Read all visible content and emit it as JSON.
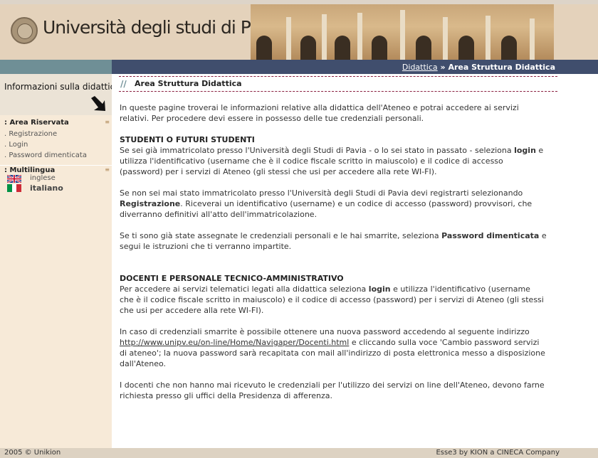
{
  "header": {
    "university_name": "Università degli studi di Pavia"
  },
  "breadcrumb": {
    "link": "Didattica",
    "separator": "»",
    "current": "Area Struttura Didattica"
  },
  "sidebar": {
    "info_title": "Informazioni sulla didattica",
    "area_riservata": {
      "title": ": Area Riservata",
      "items": [
        ". Registrazione",
        ". Login",
        ". Password dimenticata"
      ]
    },
    "multilingua": {
      "title": ": Multilingua",
      "languages": [
        "inglese",
        "italiano"
      ]
    }
  },
  "content": {
    "title": "Area Struttura Didattica",
    "title_prefix": "//",
    "intro": "In queste pagine troverai le informazioni relative alla didattica dell'Ateneo e potrai accedere ai servizi relativi. Per procedere devi essere in possesso delle tue credenziali personali.",
    "students_heading": "STUDENTI O FUTURI STUDENTI",
    "students_p1_a": "Se sei già immatricolato presso l'Università degli Studi di Pavia - o lo sei stato in passato - seleziona ",
    "students_p1_b": "login",
    "students_p1_c": " e utilizza l'identificativo (username che è il codice fiscale scritto in maiuscolo) e il codice di accesso (password) per i servizi di Ateneo (gli stessi che usi per accedere alla rete WI-FI).",
    "students_p2_a": "Se non sei mai stato immatricolato presso l'Università degli Studi di Pavia devi registrarti selezionando ",
    "students_p2_b": "Registrazione",
    "students_p2_c": ". Riceverai un identificativo (username) e un codice di accesso (password) provvisori, che diverranno definitivi all'atto dell'immatricolazione.",
    "students_p3_a": "Se ti sono già state assegnate le credenziali personali e le hai smarrite, seleziona ",
    "students_p3_b": "Password dimenticata",
    "students_p3_c": " e segui le istruzioni che ti verranno impartite.",
    "staff_heading": "DOCENTI E PERSONALE TECNICO-AMMINISTRATIVO",
    "staff_p1_a": "Per accedere ai servizi telematici legati alla didattica seleziona ",
    "staff_p1_b": "login",
    "staff_p1_c": " e utilizza l'identificativo (username che è il codice fiscale scritto in maiuscolo) e il codice di accesso (password) per i servizi di Ateneo (gli stessi che usi per accedere alla rete WI-FI).",
    "staff_p2_a": "In caso di credenziali smarrite è possibile ottenere una nuova password accedendo al seguente indirizzo ",
    "staff_p2_link": "http://www.unipv.eu/on-line/Home/Navigaper/Docenti.html",
    "staff_p2_c": " e cliccando sulla voce 'Cambio password servizi di ateneo'; la nuova password sarà recapitata con mail all'indirizzo di posta elettronica messo a disposizione dall'Ateneo.",
    "staff_p3": "I docenti che non hanno mai ricevuto le credenziali per l'utilizzo dei servizi on line dell'Ateneo, devono farne richiesta presso gli uffici della Presidenza di afferenza."
  },
  "footer": {
    "left": "2005 © Unikion",
    "right": "Esse3 by KION a CINECA Company"
  },
  "colors": {
    "nav_bar": "#404e6d",
    "sidebar_bar": "#6f8f96",
    "sidebar_bg": "#f7ead8",
    "accent_dash": "#8a2040"
  }
}
